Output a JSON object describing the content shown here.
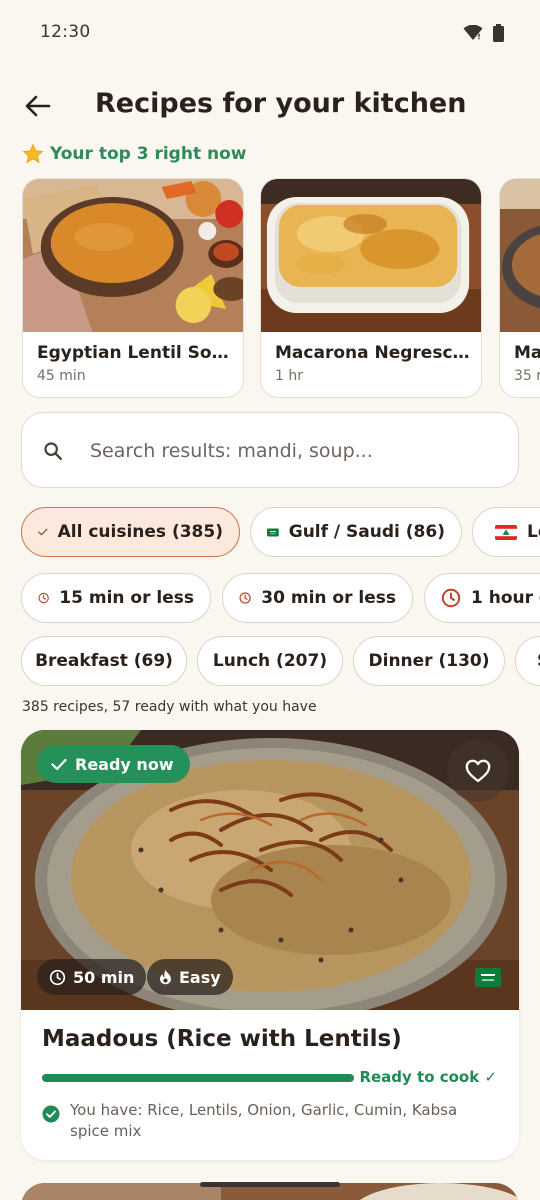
{
  "status_bar": {
    "time": "12:30"
  },
  "header": {
    "title": "Recipes for your kitchen"
  },
  "top3": {
    "label": "Your top 3 right now",
    "cards": [
      {
        "name": "Egyptian Lentil Soup",
        "time": "45 min"
      },
      {
        "name": "Macarona Negresco ...",
        "time": "1 hr"
      },
      {
        "name": "Ma",
        "time": "35 r"
      }
    ]
  },
  "search": {
    "placeholder": "Search results: mandi, soup..."
  },
  "cuisine_chips": [
    {
      "label": "All cuisines (385)",
      "selected": true
    },
    {
      "label": "Gulf / Saudi (86)",
      "flag": "saudi-flag"
    },
    {
      "label": "Le",
      "flag": "lebanon-flag"
    }
  ],
  "time_chips": [
    {
      "label": "15 min or less"
    },
    {
      "label": "30 min or less"
    },
    {
      "label": "1 hour o"
    }
  ],
  "meal_chips": [
    {
      "label": "Breakfast (69)"
    },
    {
      "label": "Lunch (207)"
    },
    {
      "label": "Dinner (130)"
    },
    {
      "label": "S"
    }
  ],
  "results": {
    "summary": "385 recipes, 57 ready with what you have"
  },
  "recipe": {
    "badge": "Ready now",
    "time": "50 min",
    "difficulty": "Easy",
    "title": "Maadous (Rice with Lentils)",
    "readiness": 1.0,
    "readiness_label": "Ready to cook ✓",
    "have": "You have: Rice, Lentils, Onion, Garlic, Cumin, Kabsa spice mix"
  },
  "colors": {
    "accent_green": "#1F8A55",
    "selected_chip_bg": "#FBE9DD",
    "selected_chip_border": "#C9744A",
    "clock_icon": "#C0442C"
  }
}
